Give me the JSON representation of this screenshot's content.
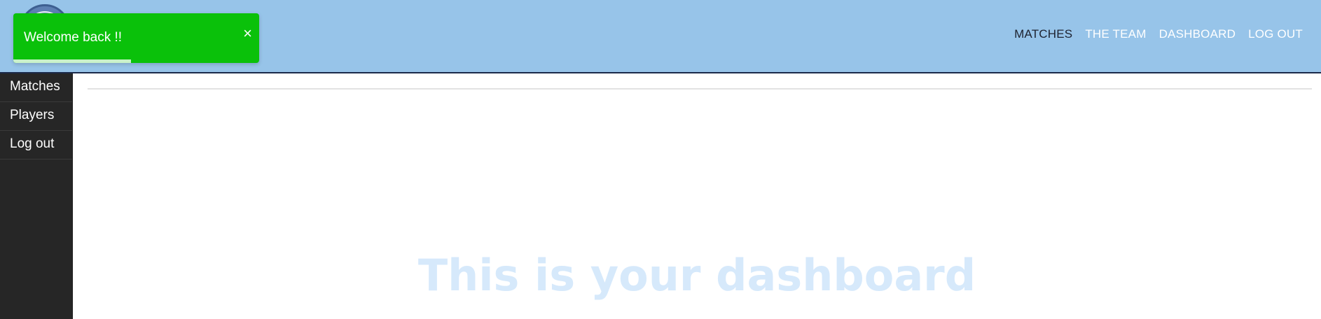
{
  "header": {
    "nav": [
      {
        "label": "MATCHES",
        "active": true
      },
      {
        "label": "THE TEAM",
        "active": false
      },
      {
        "label": "DASHBOARD",
        "active": false
      },
      {
        "label": "LOG OUT",
        "active": false
      }
    ]
  },
  "sidebar": {
    "items": [
      {
        "label": "Matches"
      },
      {
        "label": "Players"
      },
      {
        "label": "Log out"
      }
    ]
  },
  "main": {
    "hero_text": "This is your dashboard"
  },
  "toast": {
    "message": "Welcome back !!",
    "close_glyph": "×",
    "progress_fraction": 0.48
  },
  "colors": {
    "header_bg": "#97c4e9",
    "sidebar_bg": "#262626",
    "toast_bg": "#0ac10a",
    "hero_text": "#d6e9fb"
  },
  "icons": {
    "logo": "team-crest-logo",
    "toast_close": "close-icon"
  }
}
